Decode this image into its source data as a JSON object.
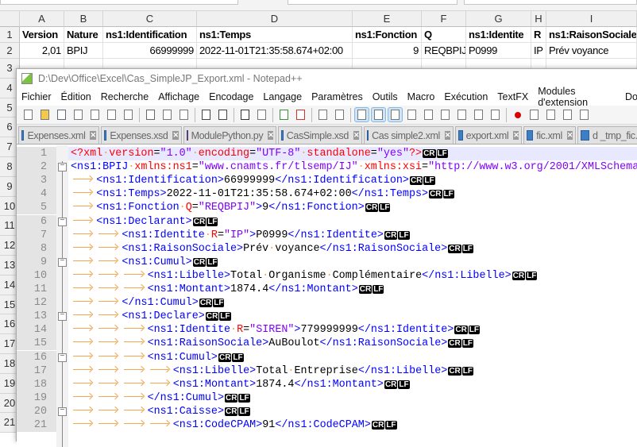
{
  "excel": {
    "columns": [
      "A",
      "B",
      "C",
      "D",
      "E",
      "F",
      "G",
      "H",
      "I"
    ],
    "rows": [
      {
        "num": "1",
        "cells": [
          "Version",
          "Nature",
          "ns1:Identification",
          "ns1:Temps",
          "ns1:Fonction",
          "Q",
          "ns1:Identite",
          "R",
          "ns1:RaisonSociale"
        ]
      },
      {
        "num": "2",
        "cells": [
          "2,01",
          "BPIJ",
          "66999999",
          "2022-11-01T21:35:58.674+02:00",
          "9",
          "REQBPIJ",
          "P0999",
          "IP",
          "Prév voyance"
        ]
      }
    ],
    "row_numbers": [
      "3",
      "4",
      "5",
      "6",
      "7",
      "8",
      "9",
      "10",
      "11",
      "12",
      "13",
      "14",
      "15",
      "16",
      "17",
      "18",
      "19",
      "20",
      "21"
    ]
  },
  "notepad": {
    "title": "D:\\Dev\\Office\\Excel\\Cas_SimpleJP_Export.xml - Notepad++",
    "menu": [
      "Fichier",
      "Édition",
      "Recherche",
      "Affichage",
      "Encodage",
      "Langage",
      "Paramètres",
      "Outils",
      "Macro",
      "Exécution",
      "TextFX",
      "Modules d'extension",
      "Do"
    ],
    "toolbar": [
      "new-file",
      "open-file",
      "save",
      "save-all",
      "close",
      "close-all",
      "print",
      "|",
      "cut",
      "copy",
      "paste",
      "|",
      "undo",
      "redo",
      "|",
      "find",
      "replace",
      "|",
      "zoom-in",
      "zoom-out",
      "|",
      "sync-vertical",
      "sync-horizontal",
      "|",
      "word-wrap",
      "show-all-chars",
      "indent-guide",
      "udl",
      "doc-map",
      "doc-list",
      "function-list",
      "folder-workspace",
      "monitor",
      "|",
      "record-macro",
      "stop-record",
      "play-macro",
      "run-macro-multiple",
      "save-macro"
    ],
    "toolbar_active": [
      "word-wrap",
      "show-all-chars",
      "indent-guide"
    ],
    "tabs": [
      {
        "label": "Expenses.xml",
        "type": "xml"
      },
      {
        "label": "Expenses.xsd",
        "type": "xml"
      },
      {
        "label": "ModulePython.py",
        "type": "py"
      },
      {
        "label": "CasSimple.xsd",
        "type": "xml"
      },
      {
        "label": "Cas simple2.xml",
        "type": "xml"
      },
      {
        "label": "export.xml",
        "type": "xml"
      },
      {
        "label": "fic.xml",
        "type": "xml"
      },
      {
        "label": "d _tmp_fic.",
        "type": "xml"
      }
    ],
    "eol": [
      "CR",
      "LF"
    ],
    "lines": [
      {
        "n": "1",
        "indent": 0,
        "fold": false,
        "eol": true,
        "t": [
          [
            "pi",
            "<?"
          ],
          [
            "pi",
            "xml"
          ],
          [
            "sp",
            " "
          ],
          [
            "attr",
            "version"
          ],
          [
            "txt",
            "="
          ],
          [
            "val",
            "\"1.0\""
          ],
          [
            "sp",
            " "
          ],
          [
            "attr",
            "encoding"
          ],
          [
            "txt",
            "="
          ],
          [
            "val",
            "\"UTF-8\""
          ],
          [
            "sp",
            " "
          ],
          [
            "attr",
            "standalone"
          ],
          [
            "txt",
            "="
          ],
          [
            "val",
            "\"yes\""
          ],
          [
            "pi",
            "?>"
          ]
        ]
      },
      {
        "n": "2",
        "indent": 0,
        "fold": true,
        "eol": false,
        "t": [
          [
            "tag",
            "<ns1:BPIJ"
          ],
          [
            "sp",
            " "
          ],
          [
            "attr",
            "xmlns:ns1"
          ],
          [
            "txt",
            "="
          ],
          [
            "val",
            "\"www.cnamts.fr/tlsemp/IJ\""
          ],
          [
            "sp",
            " "
          ],
          [
            "attr",
            "xmlns:xsi"
          ],
          [
            "txt",
            "="
          ],
          [
            "val",
            "\"http://www.w3.org/2001/XMLSchema-"
          ]
        ]
      },
      {
        "n": "3",
        "indent": 1,
        "eol": true,
        "t": [
          [
            "tag",
            "<ns1:Identification>"
          ],
          [
            "txt",
            "66999999"
          ],
          [
            "tag",
            "</ns1:Identification>"
          ]
        ]
      },
      {
        "n": "4",
        "indent": 1,
        "eol": true,
        "t": [
          [
            "tag",
            "<ns1:Temps>"
          ],
          [
            "txt",
            "2022-11-01T21:35:58.674+02:00"
          ],
          [
            "tag",
            "</ns1:Temps>"
          ]
        ]
      },
      {
        "n": "5",
        "indent": 1,
        "eol": true,
        "t": [
          [
            "tag",
            "<ns1:Fonction"
          ],
          [
            "sp",
            " "
          ],
          [
            "attr",
            "Q"
          ],
          [
            "txt",
            "="
          ],
          [
            "val",
            "\"REQBPIJ\""
          ],
          [
            "tag",
            ">"
          ],
          [
            "txt",
            "9"
          ],
          [
            "tag",
            "</ns1:Fonction>"
          ]
        ]
      },
      {
        "n": "6",
        "indent": 1,
        "fold": true,
        "eol": true,
        "t": [
          [
            "tag",
            "<ns1:Declarant>"
          ]
        ]
      },
      {
        "n": "7",
        "indent": 2,
        "eol": true,
        "t": [
          [
            "tag",
            "<ns1:Identite"
          ],
          [
            "sp",
            " "
          ],
          [
            "attr",
            "R"
          ],
          [
            "txt",
            "="
          ],
          [
            "val",
            "\"IP\""
          ],
          [
            "tag",
            ">"
          ],
          [
            "txt",
            "P0999"
          ],
          [
            "tag",
            "</ns1:Identite>"
          ]
        ]
      },
      {
        "n": "8",
        "indent": 2,
        "eol": true,
        "t": [
          [
            "tag",
            "<ns1:RaisonSociale>"
          ],
          [
            "txt",
            "Prév voyance"
          ],
          [
            "tag",
            "</ns1:RaisonSociale>"
          ]
        ]
      },
      {
        "n": "9",
        "indent": 2,
        "fold": true,
        "eol": true,
        "t": [
          [
            "tag",
            "<ns1:Cumul>"
          ]
        ]
      },
      {
        "n": "10",
        "indent": 3,
        "eol": true,
        "t": [
          [
            "tag",
            "<ns1:Libelle>"
          ],
          [
            "txt",
            "Total Organisme Complémentaire"
          ],
          [
            "tag",
            "</ns1:Libelle>"
          ]
        ]
      },
      {
        "n": "11",
        "indent": 3,
        "eol": true,
        "t": [
          [
            "tag",
            "<ns1:Montant>"
          ],
          [
            "txt",
            "1874.4"
          ],
          [
            "tag",
            "</ns1:Montant>"
          ]
        ]
      },
      {
        "n": "12",
        "indent": 2,
        "eol": true,
        "t": [
          [
            "tag",
            "</ns1:Cumul>"
          ]
        ]
      },
      {
        "n": "13",
        "indent": 2,
        "fold": true,
        "eol": true,
        "t": [
          [
            "tag",
            "<ns1:Declare>"
          ]
        ]
      },
      {
        "n": "14",
        "indent": 3,
        "eol": true,
        "t": [
          [
            "tag",
            "<ns1:Identite"
          ],
          [
            "sp",
            " "
          ],
          [
            "attr",
            "R"
          ],
          [
            "txt",
            "="
          ],
          [
            "val",
            "\"SIREN\""
          ],
          [
            "tag",
            ">"
          ],
          [
            "txt",
            "779999999"
          ],
          [
            "tag",
            "</ns1:Identite>"
          ]
        ]
      },
      {
        "n": "15",
        "indent": 3,
        "eol": true,
        "t": [
          [
            "tag",
            "<ns1:RaisonSociale>"
          ],
          [
            "txt",
            "AuBoulot"
          ],
          [
            "tag",
            "</ns1:RaisonSociale>"
          ]
        ]
      },
      {
        "n": "16",
        "indent": 3,
        "fold": true,
        "eol": true,
        "t": [
          [
            "tag",
            "<ns1:Cumul>"
          ]
        ]
      },
      {
        "n": "17",
        "indent": 4,
        "eol": true,
        "t": [
          [
            "tag",
            "<ns1:Libelle>"
          ],
          [
            "txt",
            "Total Entreprise"
          ],
          [
            "tag",
            "</ns1:Libelle>"
          ]
        ]
      },
      {
        "n": "18",
        "indent": 4,
        "eol": true,
        "t": [
          [
            "tag",
            "<ns1:Montant>"
          ],
          [
            "txt",
            "1874.4"
          ],
          [
            "tag",
            "</ns1:Montant>"
          ]
        ]
      },
      {
        "n": "19",
        "indent": 3,
        "eol": true,
        "t": [
          [
            "tag",
            "</ns1:Cumul>"
          ]
        ]
      },
      {
        "n": "20",
        "indent": 3,
        "fold": true,
        "eol": true,
        "t": [
          [
            "tag",
            "<ns1:Caisse>"
          ]
        ]
      },
      {
        "n": "21",
        "indent": 4,
        "eol": true,
        "t": [
          [
            "tag",
            "<ns1:CodeCPAM>"
          ],
          [
            "txt",
            "91"
          ],
          [
            "tag",
            "</ns1:CodeCPAM>"
          ]
        ]
      }
    ]
  }
}
